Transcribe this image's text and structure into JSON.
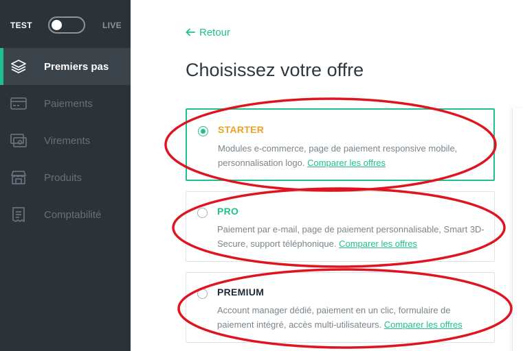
{
  "mode": {
    "test_label": "TEST",
    "live_label": "LIVE",
    "live_enabled": false
  },
  "sidebar": {
    "items": [
      {
        "label": "Premiers pas",
        "icon": "layers-icon",
        "active": true
      },
      {
        "label": "Paiements",
        "icon": "credit-card-icon",
        "active": false
      },
      {
        "label": "Virements",
        "icon": "money-transfer-icon",
        "active": false
      },
      {
        "label": "Produits",
        "icon": "store-icon",
        "active": false
      },
      {
        "label": "Comptabilité",
        "icon": "receipt-icon",
        "active": false
      }
    ]
  },
  "main": {
    "back_label": "Retour",
    "title": "Choisissez votre offre",
    "compare_link": "Comparer les offres",
    "plans": [
      {
        "name": "STARTER",
        "color": "#f0a024",
        "selected": true,
        "description": "Modules e-commerce, page de paiement responsive mobile, personnalisation logo."
      },
      {
        "name": "PRO",
        "color": "#1fbf8f",
        "selected": false,
        "description": "Paiement par e-mail, page de paiement personnalisable, Smart 3D-Secure, support téléphonique."
      },
      {
        "name": "PREMIUM",
        "color": "#1d2a36",
        "selected": false,
        "description": "Account manager dédié, paiement en un clic, formulaire de paiement intégré, accès multi-utilisateurs."
      }
    ]
  },
  "colors": {
    "accent": "#1fbf8f",
    "sidebar_bg": "#2b3238",
    "annotation": "#e0141e"
  }
}
